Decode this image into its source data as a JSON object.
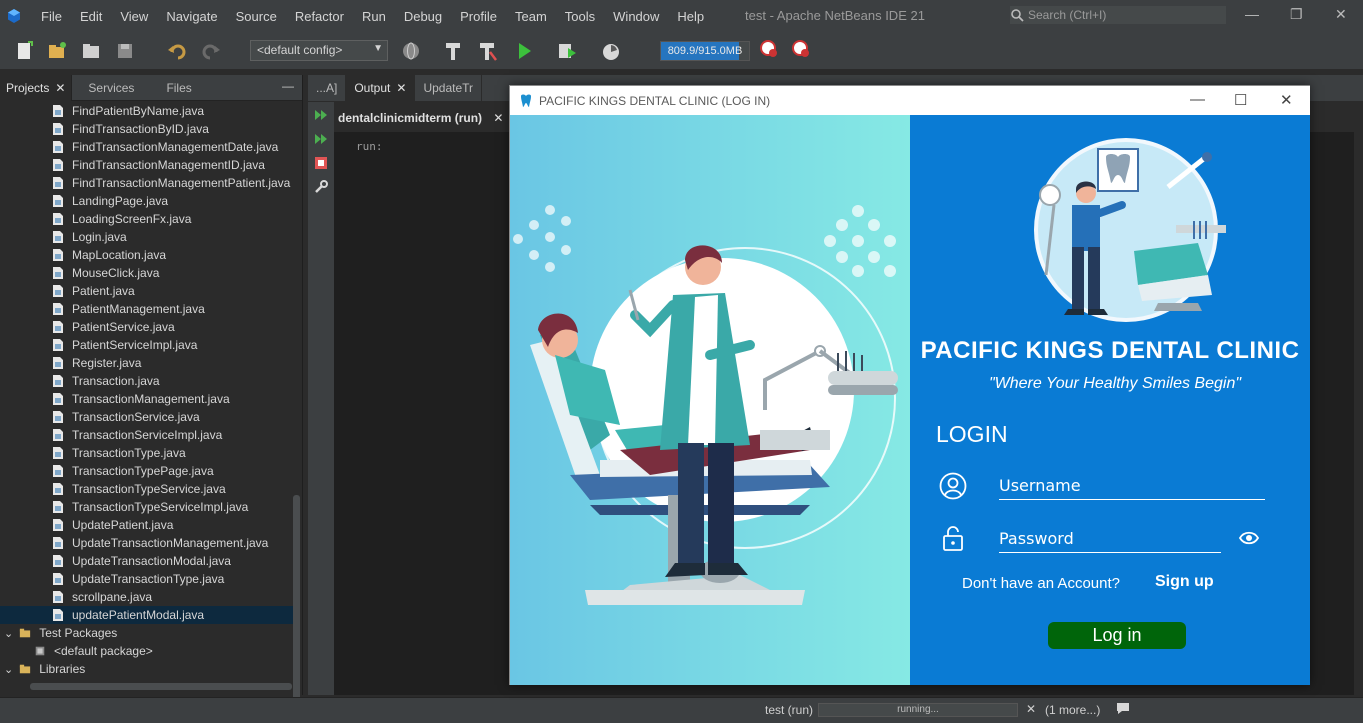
{
  "menubar": {
    "items": [
      "File",
      "Edit",
      "View",
      "Navigate",
      "Source",
      "Refactor",
      "Run",
      "Debug",
      "Profile",
      "Team",
      "Tools",
      "Window",
      "Help"
    ],
    "window_title": "test - Apache NetBeans IDE 21",
    "search_placeholder": "Search (Ctrl+I)"
  },
  "toolbar": {
    "config": "<default config>",
    "memory": "809.9/915.0MB",
    "memory_fraction": 0.885
  },
  "projects_panel": {
    "tabs": [
      "Projects",
      "Services",
      "Files"
    ],
    "files": [
      "FindPatientByName.java",
      "FindTransactionByID.java",
      "FindTransactionManagementDate.java",
      "FindTransactionManagementID.java",
      "FindTransactionManagementPatient.java",
      "LandingPage.java",
      "LoadingScreenFx.java",
      "Login.java",
      "MapLocation.java",
      "MouseClick.java",
      "Patient.java",
      "PatientManagement.java",
      "PatientService.java",
      "PatientServiceImpl.java",
      "Register.java",
      "Transaction.java",
      "TransactionManagement.java",
      "TransactionService.java",
      "TransactionServiceImpl.java",
      "TransactionType.java",
      "TransactionTypePage.java",
      "TransactionTypeService.java",
      "TransactionTypeServiceImpl.java",
      "UpdatePatient.java",
      "UpdateTransactionManagement.java",
      "UpdateTransactionModal.java",
      "UpdateTransactionType.java",
      "scrollpane.java",
      "updatePatientModal.java"
    ],
    "selected_index": 28,
    "test_packages": "Test Packages",
    "default_package": "<default package>",
    "libraries": "Libraries"
  },
  "editor": {
    "tabs": [
      "...A]",
      "Output",
      "UpdateTr"
    ],
    "output_subtab": "dentalclinicmidterm (run)",
    "console_text": "run:"
  },
  "status": {
    "task": "test (run)",
    "progress_text": "running...",
    "more": "(1 more...)"
  },
  "dialog": {
    "title": "PACIFIC KINGS DENTAL CLINIC (LOG IN)",
    "brand": "PACIFIC KINGS DENTAL CLINIC",
    "tagline": "\"Where Your Healthy Smiles Begin\"",
    "login_heading": "LOGIN",
    "username_placeholder": "Username",
    "password_placeholder": "Password",
    "no_account": "Don't have an Account?",
    "signup": "Sign up",
    "login_button": "Log in",
    "colors": {
      "right_panel": "#0a7bd4",
      "login_button": "#00650a",
      "left_gradient_start": "#6ac6e4",
      "left_gradient_end": "#86e9e4"
    }
  }
}
